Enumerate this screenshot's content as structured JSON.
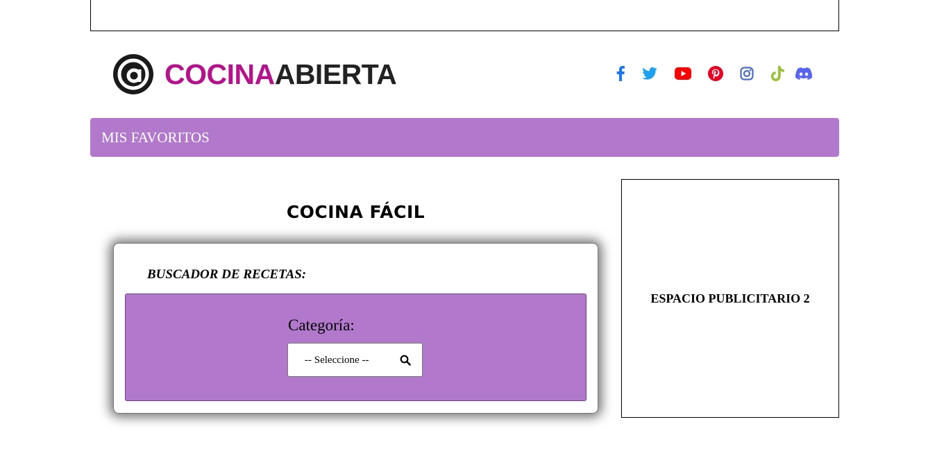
{
  "header": {
    "logo": {
      "text_part1": "COCINA",
      "text_part2": "ABIERTA",
      "brand_color": "#b4138b"
    },
    "social": [
      {
        "name": "facebook-icon",
        "color": "#1877f2"
      },
      {
        "name": "twitter-icon",
        "color": "#1da1f2"
      },
      {
        "name": "youtube-icon",
        "color": "#ff0000"
      },
      {
        "name": "pinterest-icon",
        "color": "#e60023"
      },
      {
        "name": "instagram-icon",
        "color": "#4a6cc9"
      },
      {
        "name": "tiktok-icon",
        "color": "#9bc23c"
      },
      {
        "name": "discord-icon",
        "color": "#5865f2"
      }
    ]
  },
  "nav": {
    "label": "MIS FAVORITOS",
    "color": "#b278cc"
  },
  "main": {
    "title": "COCINA FÁCIL",
    "search": {
      "heading": "BUSCADOR DE RECETAS:",
      "category_label": "Categoría:",
      "category_value": "-- Seleccione --",
      "icon": "search-icon"
    }
  },
  "sidebar": {
    "ad_label": "ESPACIO PUBLICITARIO 2"
  }
}
